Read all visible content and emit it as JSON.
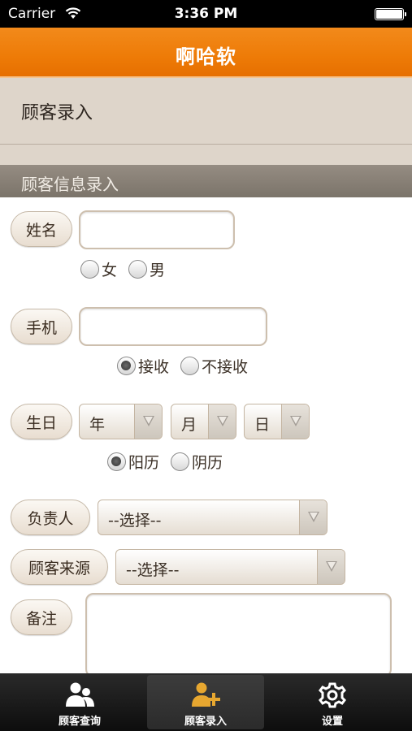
{
  "status_bar": {
    "carrier": "Carrier",
    "time": "3:36 PM"
  },
  "nav": {
    "title": "啊哈软"
  },
  "page": {
    "title": "顾客录入"
  },
  "section": {
    "title": "顾客信息录入"
  },
  "form": {
    "name": {
      "label": "姓名",
      "value": ""
    },
    "gender": {
      "options": [
        "女",
        "男"
      ],
      "selected": null
    },
    "phone": {
      "label": "手机",
      "value": ""
    },
    "sms": {
      "options": [
        "接收",
        "不接收"
      ],
      "selected": "接收"
    },
    "birthday": {
      "label": "生日",
      "year": "年",
      "month": "月",
      "day": "日"
    },
    "calendar": {
      "options": [
        "阳历",
        "阴历"
      ],
      "selected": "阳历"
    },
    "manager": {
      "label": "负责人",
      "value": "--选择--"
    },
    "source": {
      "label": "顾客来源",
      "value": "--选择--"
    },
    "notes": {
      "label": "备注",
      "value": ""
    }
  },
  "tabbar": {
    "items": [
      {
        "label": "顾客查询",
        "icon": "users-icon",
        "active": false
      },
      {
        "label": "顾客录入",
        "icon": "add-user-icon",
        "active": true
      },
      {
        "label": "设置",
        "icon": "gear-icon",
        "active": false
      }
    ]
  },
  "colors": {
    "accent": "#ee7b07",
    "active_icon": "#e7a730"
  }
}
